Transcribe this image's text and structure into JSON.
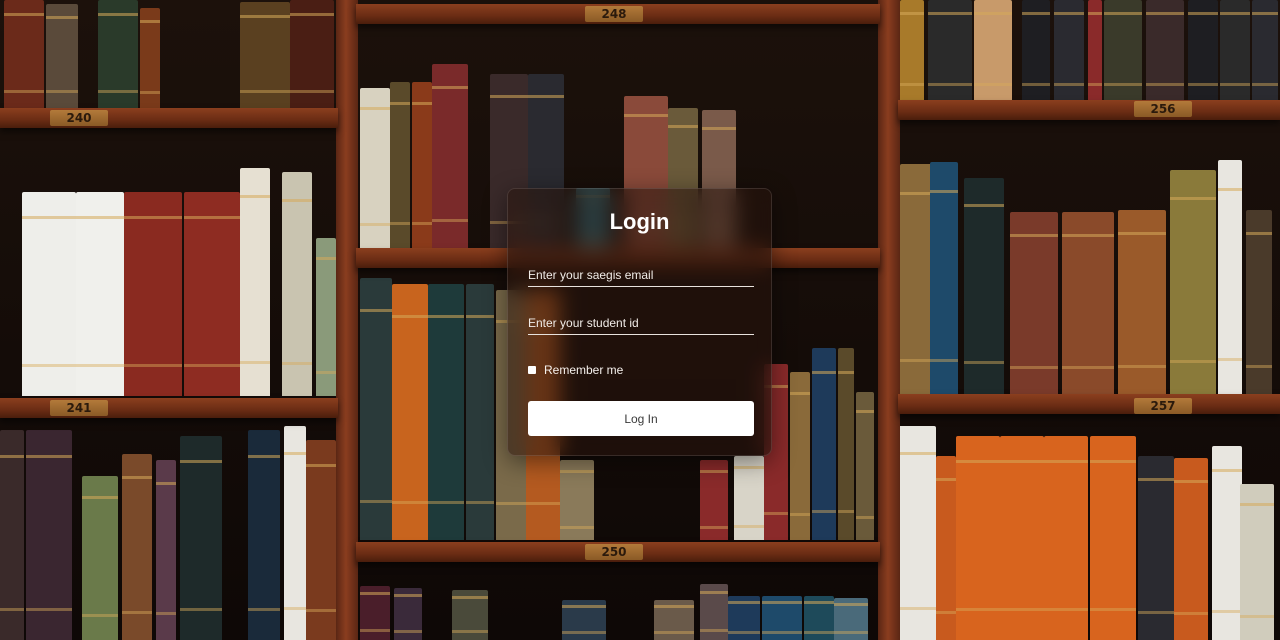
{
  "background": {
    "description_icon": "bookshelf-background",
    "shelf_labels": [
      "240",
      "248",
      "256",
      "241",
      "250",
      "257"
    ]
  },
  "login": {
    "title": "Login",
    "email_placeholder": "Enter your saegis email",
    "student_id_placeholder": "Enter your student id",
    "remember_label": "Remember me",
    "submit_label": "Log In"
  },
  "colors": {
    "card_bg": "#28140c",
    "button_bg": "#ffffff",
    "text": "#ffffff",
    "wood": "#8b3f1e"
  }
}
